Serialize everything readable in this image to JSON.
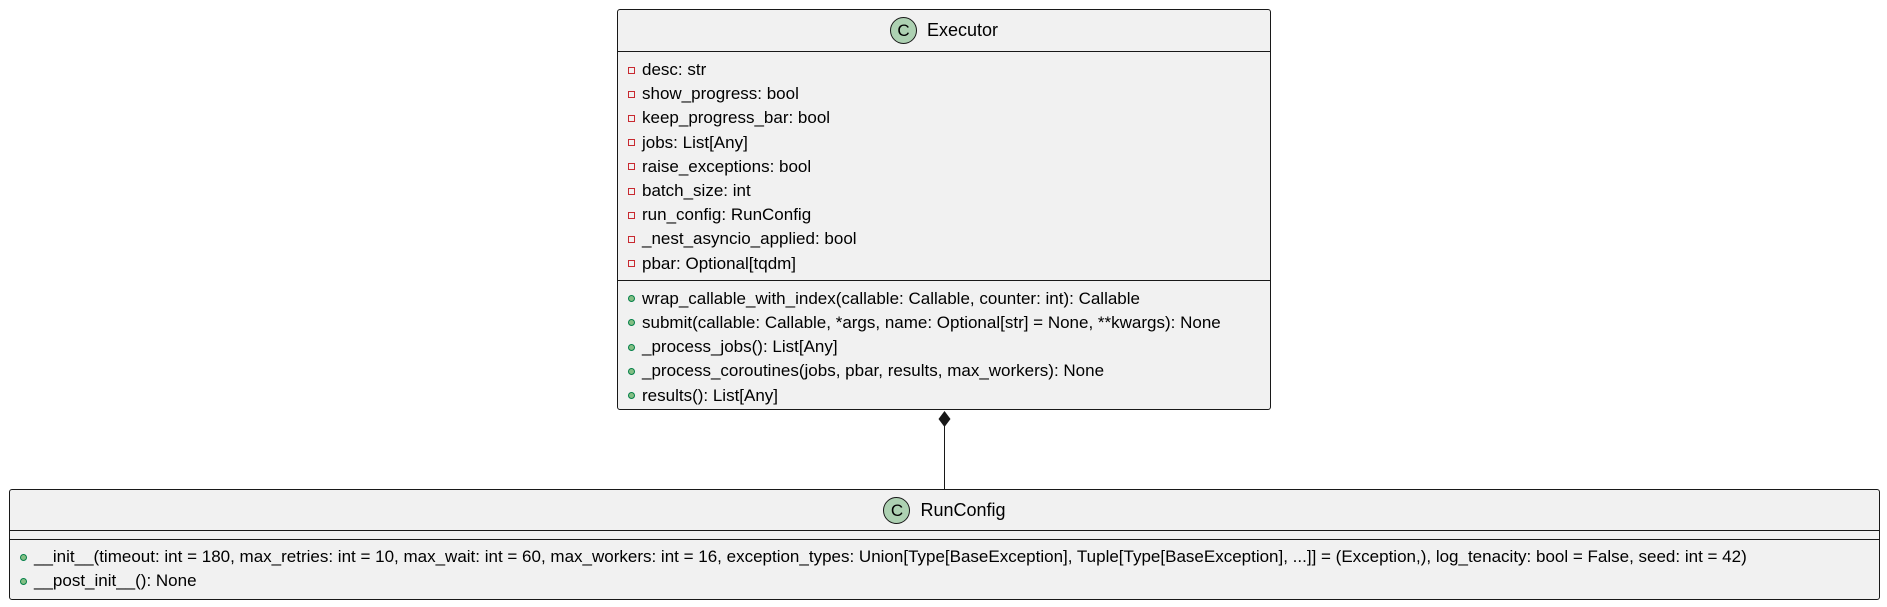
{
  "classes": {
    "executor": {
      "icon": "C",
      "name": "Executor",
      "attributes": [
        "desc: str",
        "show_progress: bool",
        "keep_progress_bar: bool",
        "jobs: List[Any]",
        "raise_exceptions: bool",
        "batch_size: int",
        "run_config: RunConfig",
        "_nest_asyncio_applied: bool",
        "pbar: Optional[tqdm]"
      ],
      "methods": [
        "wrap_callable_with_index(callable: Callable, counter: int): Callable",
        "submit(callable: Callable, *args, name: Optional[str] = None, **kwargs): None",
        "_process_jobs(): List[Any]",
        "_process_coroutines(jobs, pbar, results, max_workers): None",
        "results(): List[Any]"
      ]
    },
    "runconfig": {
      "icon": "C",
      "name": "RunConfig",
      "attributes": [],
      "methods": [
        "__init__(timeout: int = 180, max_retries: int = 10, max_wait: int = 60, max_workers: int = 16, exception_types: Union[Type[BaseException], Tuple[Type[BaseException], ...]] = (Exception,), log_tenacity: bool = False, seed: int = 42)",
        "__post_init__(): None"
      ]
    }
  },
  "relations": [
    {
      "from": "executor",
      "to": "runconfig",
      "type": "composition"
    }
  ],
  "colors": {
    "box_fill": "#f1f1f1",
    "border": "#181818",
    "class_icon": "#add1b2",
    "private_marker": "#c82930",
    "public_marker": "#84be84"
  }
}
